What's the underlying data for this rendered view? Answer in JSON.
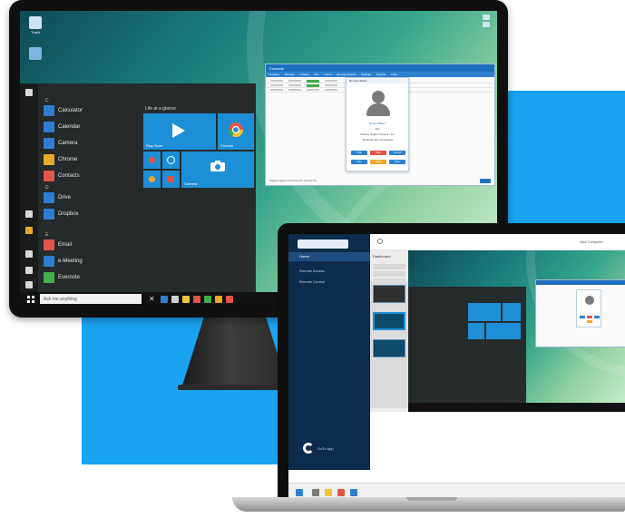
{
  "desktop": {
    "desktop_icons": [
      {
        "label": "Trash",
        "icon": "recycle-bin-icon"
      },
      {
        "label": "",
        "icon": "app-shortcut-icon"
      }
    ],
    "start_menu": {
      "letters": [
        "C",
        "D",
        "E"
      ],
      "apps": [
        {
          "label": "Calculator",
          "color": "#2d7dd2"
        },
        {
          "label": "Calendar",
          "color": "#2d7dd2"
        },
        {
          "label": "Camera",
          "color": "#2d7dd2"
        },
        {
          "label": "Chrome",
          "color": "#e8a82c"
        },
        {
          "label": "Contacts",
          "color": "#e2544a"
        },
        {
          "label": "Drive",
          "color": "#2d7dd2"
        },
        {
          "label": "Dropbox",
          "color": "#2d7dd2"
        },
        {
          "label": "Email",
          "color": "#2d7dd2"
        },
        {
          "label": "e-Meeting",
          "color": "#2d7dd2"
        },
        {
          "label": "Evernote",
          "color": "#47b04b"
        }
      ],
      "tiles_header": "Life at a glance",
      "tiles": [
        {
          "label": "Play Store",
          "icon": "play-store-icon"
        },
        {
          "label": "Chrome",
          "icon": "chrome-icon"
        },
        {
          "label": "",
          "icon": "small-tiles-icon"
        },
        {
          "label": "Camera",
          "icon": "camera-icon"
        }
      ]
    },
    "taskbar": {
      "search_placeholder": "Ask me anything",
      "close_glyph": "✕"
    },
    "remote_window": {
      "title": "Contacts",
      "tabs": [
        "Contacts",
        "Devices",
        "Groups",
        "Info",
        "Users",
        "Remote Access",
        "Settings",
        "Reports",
        "Help"
      ],
      "card": {
        "title": "Remote Status",
        "name": "Robert Baker",
        "role": "Idle",
        "line1": "Online | Support Queue | 1m",
        "line2": "Windows 10 | Connected",
        "buttons": [
          {
            "label": "Chat",
            "color": "#2f80d0"
          },
          {
            "label": "View",
            "color": "#e2544a"
          },
          {
            "label": "Control",
            "color": "#2f80d0"
          },
          {
            "label": "Files",
            "color": "#2f80d0"
          },
          {
            "label": "Notes",
            "color": "#f2a62c"
          },
          {
            "label": "More",
            "color": "#2f80d0"
          }
        ]
      },
      "footer": "Support agent connected to remote PC"
    }
  },
  "laptop": {
    "sidebar": {
      "nav": [
        "Home",
        "Remote Access",
        "Remote Control"
      ],
      "bottom_label": "GoTo App"
    },
    "header": {
      "action_label": "Add Computer"
    },
    "list": {
      "title": "Dashboard"
    }
  }
}
